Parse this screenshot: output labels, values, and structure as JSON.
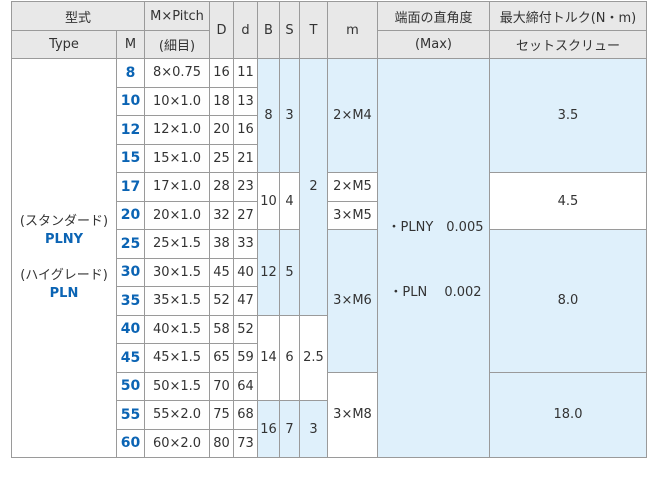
{
  "headers": {
    "model_jp": "型式",
    "type": "Type",
    "m": "M",
    "m_pitch": "M×Pitch",
    "fine": "(細目)",
    "d_big": "D",
    "d_small": "d",
    "b": "B",
    "s": "S",
    "t": "T",
    "mm": "m",
    "squareness": "端面の直角度",
    "max": "(Max)",
    "torque": "最大締付トルク(N・m)",
    "set_screw": "セットスクリュー"
  },
  "types": {
    "standard_label": "(スタンダード)",
    "standard_name": "PLNY",
    "high_label": "(ハイグレード)",
    "high_name": "PLN"
  },
  "rows": [
    {
      "m": "8",
      "pitch": "8×0.75",
      "D": "16",
      "d": "11"
    },
    {
      "m": "10",
      "pitch": "10×1.0",
      "D": "18",
      "d": "13"
    },
    {
      "m": "12",
      "pitch": "12×1.0",
      "D": "20",
      "d": "16"
    },
    {
      "m": "15",
      "pitch": "15×1.0",
      "D": "25",
      "d": "21"
    },
    {
      "m": "17",
      "pitch": "17×1.0",
      "D": "28",
      "d": "23"
    },
    {
      "m": "20",
      "pitch": "20×1.0",
      "D": "32",
      "d": "27"
    },
    {
      "m": "25",
      "pitch": "25×1.5",
      "D": "38",
      "d": "33"
    },
    {
      "m": "30",
      "pitch": "30×1.5",
      "D": "45",
      "d": "40"
    },
    {
      "m": "35",
      "pitch": "35×1.5",
      "D": "52",
      "d": "47"
    },
    {
      "m": "40",
      "pitch": "40×1.5",
      "D": "58",
      "d": "52"
    },
    {
      "m": "45",
      "pitch": "45×1.5",
      "D": "65",
      "d": "59"
    },
    {
      "m": "50",
      "pitch": "50×1.5",
      "D": "70",
      "d": "64"
    },
    {
      "m": "55",
      "pitch": "55×2.0",
      "D": "75",
      "d": "68"
    },
    {
      "m": "60",
      "pitch": "60×2.0",
      "D": "80",
      "d": "73"
    }
  ],
  "groups": {
    "b": [
      "8",
      "10",
      "12",
      "14",
      "16"
    ],
    "s": [
      "3",
      "4",
      "5",
      "6",
      "7"
    ],
    "t": [
      "2",
      "2.5",
      "3"
    ],
    "m": [
      "2×M4",
      "2×M5",
      "3×M5",
      "3×M6",
      "3×M8"
    ],
    "torque": [
      "3.5",
      "4.5",
      "8.0",
      "18.0"
    ]
  },
  "squareness": {
    "plny": "・PLNY　0.005",
    "pln": "・PLN　 0.002"
  }
}
